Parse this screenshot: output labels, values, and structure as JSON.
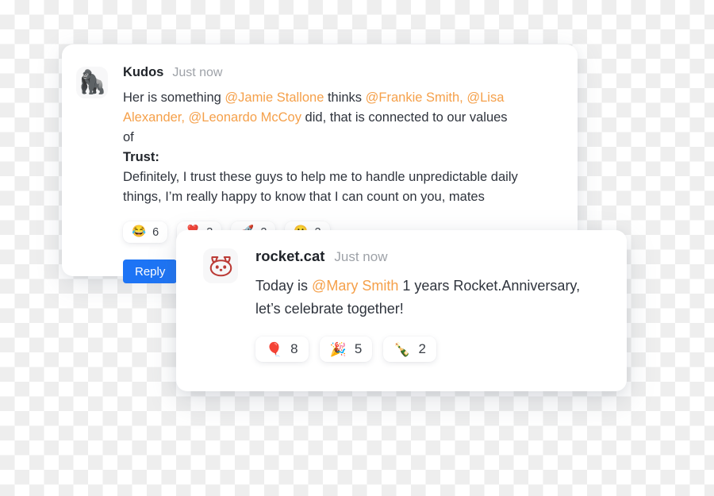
{
  "messages": [
    {
      "id": "kudos",
      "avatar_icon": "gorilla-emoji-avatar",
      "avatar_glyph": "🦍",
      "author": "Kudos",
      "timestamp": "Just now",
      "text_segments": [
        {
          "type": "plain",
          "text": "Her is something "
        },
        {
          "type": "mention",
          "text": "@Jamie Stallone"
        },
        {
          "type": "plain",
          "text": " thinks "
        },
        {
          "type": "mention",
          "text": "@Frankie Smith, @Lisa Alexander, @Leonardo McCoy"
        },
        {
          "type": "plain",
          "text": " did, that is connected to our values of"
        },
        {
          "type": "break",
          "text": ""
        },
        {
          "type": "bold",
          "text": "Trust:"
        },
        {
          "type": "break",
          "text": ""
        },
        {
          "type": "plain",
          "text": "Definitely, I trust these guys to help me to handle unpredictable daily things, I’m really happy to know that I can count on you, mates"
        }
      ],
      "reactions": [
        {
          "icon": "face-with-tears-of-joy-emoji",
          "emoji": "😂",
          "count": "6"
        },
        {
          "icon": "heart-exclamation-emoji",
          "emoji": "❣️",
          "count": "3"
        },
        {
          "icon": "rocket-emoji",
          "emoji": "🚀",
          "count": "2"
        },
        {
          "icon": "grinning-face-emoji",
          "emoji": "😀",
          "count": "2"
        }
      ],
      "reply_label": "Reply"
    },
    {
      "id": "rocketcat",
      "avatar_icon": "rocket-cat-logo-avatar",
      "author": "rocket.cat",
      "timestamp": "Just now",
      "text_segments": [
        {
          "type": "plain",
          "text": "Today is "
        },
        {
          "type": "mention",
          "text": "@Mary Smith"
        },
        {
          "type": "plain",
          "text": " 1 years Rocket.Anniversary, let’s celebrate together!"
        }
      ],
      "reactions": [
        {
          "icon": "balloon-emoji",
          "emoji": "🎈",
          "count": "8"
        },
        {
          "icon": "party-popper-emoji",
          "emoji": "🎉",
          "count": "5"
        },
        {
          "icon": "bottle-with-popping-cork-emoji",
          "emoji": "🍾",
          "count": "2"
        }
      ]
    }
  ],
  "colors": {
    "mention": "#f5a04a",
    "reply_button": "#1d74f5",
    "author_text": "#1f2329",
    "body_text": "#2f343d",
    "timestamp_text": "#9ea2a8",
    "rocket_cat_logo": "#bb3b36",
    "card_background": "#ffffff"
  }
}
